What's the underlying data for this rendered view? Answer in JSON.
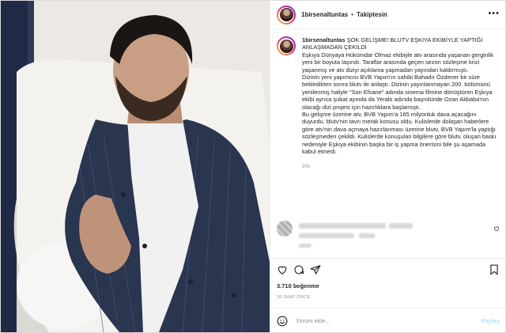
{
  "post": {
    "username": "1birsenaltuntas",
    "separator": "•",
    "follow_status": "Takiptesin",
    "caption": {
      "username": "1birsenaltuntas",
      "title": "ŞOK GELİŞME! BLUTV EŞKIYA EKİBİYLE YAPTIĞI ANLAŞMADAN ÇEKİLDİ",
      "paragraphs": [
        "Eşkıya Dünyaya Hükümdar Olmaz ekibiyle atv arasında yaşanan gerginlik yeni bir boyuta taşındı. Taraflar arasında geçen sezon sözleşme krizi yaşanmış ve atv diziyi açıklama yapmadan yayından kaldırmıştı.",
        "Dizinin yeni yapımcısı BVB Yapım'ın sahibi Bahadır Özdener bir süre bekledikten sonra blutv ile anlaştı. Dizinin yayınlanmayan 200. bölümünü yenilenmiş haliyle \"Son Efsane\" adında sinema filmine dönüştüren Eşkıya ekibi ayrıca şubat ayında da Yeraltı adında başrolünde Ozan Akbaba'nın olacağı dizi projesi için hazırlıklara başlamıştı.",
        "Bu gelişme üzerine atv, BVB Yapım'a 165 milyonluk dava açacağını duyurdu. blutv'nin tavrı merak konusu oldu. Kulislerde dolaşan haberlere göre atv'nin dava açmaya hazırlanması üzerine blutv, BVB Yapım'la yaptığı sözleşmeden çekildi. Kulislerde konuşulan bilgilere göre blutv, oluşan baskı nedeniyle Eşkıya ekibinin başka bir iş yapma önerisini bile şu aşamada kabul etmedi."
      ],
      "time": "20s"
    },
    "likes": "3.710 beğenme",
    "date": "20 SAAT ÖNCE",
    "comment_placeholder": "Yorum ekle...",
    "post_button": "Paylaş",
    "icons": {
      "more": "more-options-icon",
      "like": "heart-icon",
      "comment": "comment-icon",
      "share": "share-icon",
      "save": "bookmark-icon",
      "emoji": "emoji-icon"
    }
  }
}
